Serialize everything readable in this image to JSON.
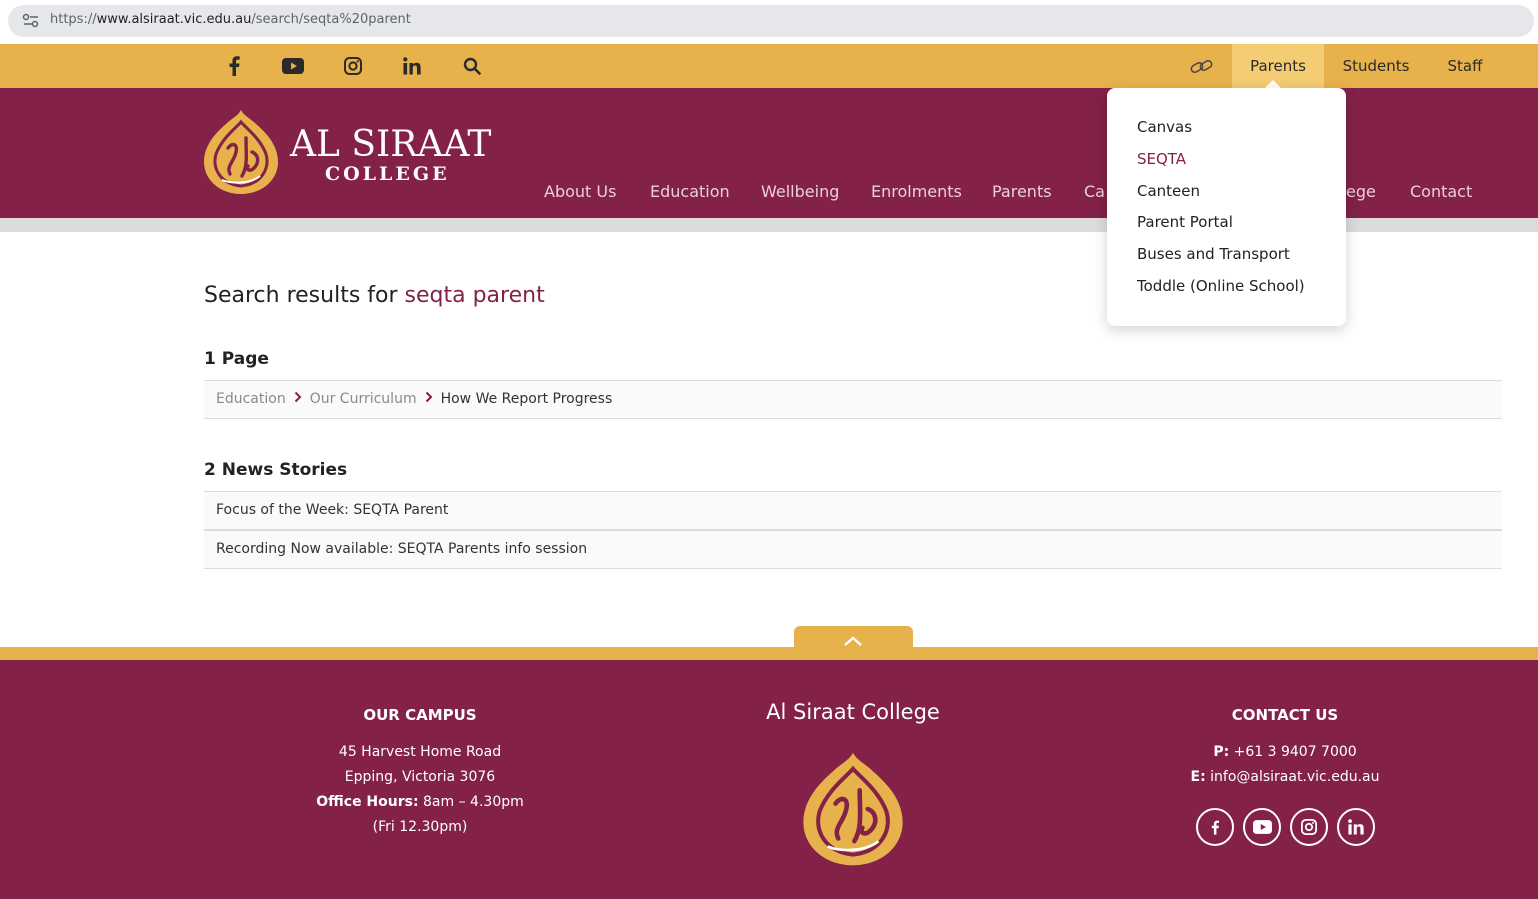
{
  "browser": {
    "url_prefix": "https://",
    "url_host": "www.alsiraat.vic.edu.au",
    "url_path": "/search/seqta%20parent"
  },
  "utility_bar": {
    "socials": [
      "facebook-icon",
      "youtube-icon",
      "instagram-icon",
      "linkedin-icon",
      "search-icon"
    ],
    "tabs": [
      "Parents",
      "Students",
      "Staff"
    ],
    "active_tab": "Parents"
  },
  "header": {
    "logo_title": "AL SIRAAT",
    "logo_sub": "COLLEGE",
    "nav": [
      "About Us",
      "Education",
      "Wellbeing",
      "Enrolments",
      "Parents",
      "Ca",
      "ege",
      "Contact"
    ]
  },
  "dropdown": {
    "items": [
      "Canvas",
      "SEQTA",
      "Canteen",
      "Parent Portal",
      "Buses and Transport",
      "Toddle (Online School)"
    ],
    "current": "SEQTA"
  },
  "main": {
    "heading_prefix": "Search results for ",
    "search_term": "seqta parent",
    "pages_title": "1 Page",
    "page_breadcrumb": [
      "Education",
      "Our Curriculum",
      "How We Report Progress"
    ],
    "news_title": "2 News Stories",
    "news": [
      "Focus of the Week: SEQTA Parent",
      "Recording Now available: SEQTA Parents info session"
    ]
  },
  "footer": {
    "campus_heading": "OUR CAMPUS",
    "campus_address1": "45 Harvest Home Road",
    "campus_address2": "Epping, Victoria 3076",
    "office_hours_label": "Office Hours:",
    "office_hours_value": " 8am – 4.30pm",
    "office_hours_fri": "(Fri 12.30pm)",
    "brand": "Al Siraat College",
    "contact_heading": "CONTACT US",
    "phone_label": "P:",
    "phone_value": " +61  3  9407 7000",
    "email_label": "E:",
    "email_value": " info@alsiraat.vic.edu.au",
    "socials": [
      "facebook-icon",
      "youtube-icon",
      "instagram-icon",
      "linkedin-icon"
    ]
  },
  "colors": {
    "maroon": "#832148",
    "gold": "#e7b24b"
  }
}
